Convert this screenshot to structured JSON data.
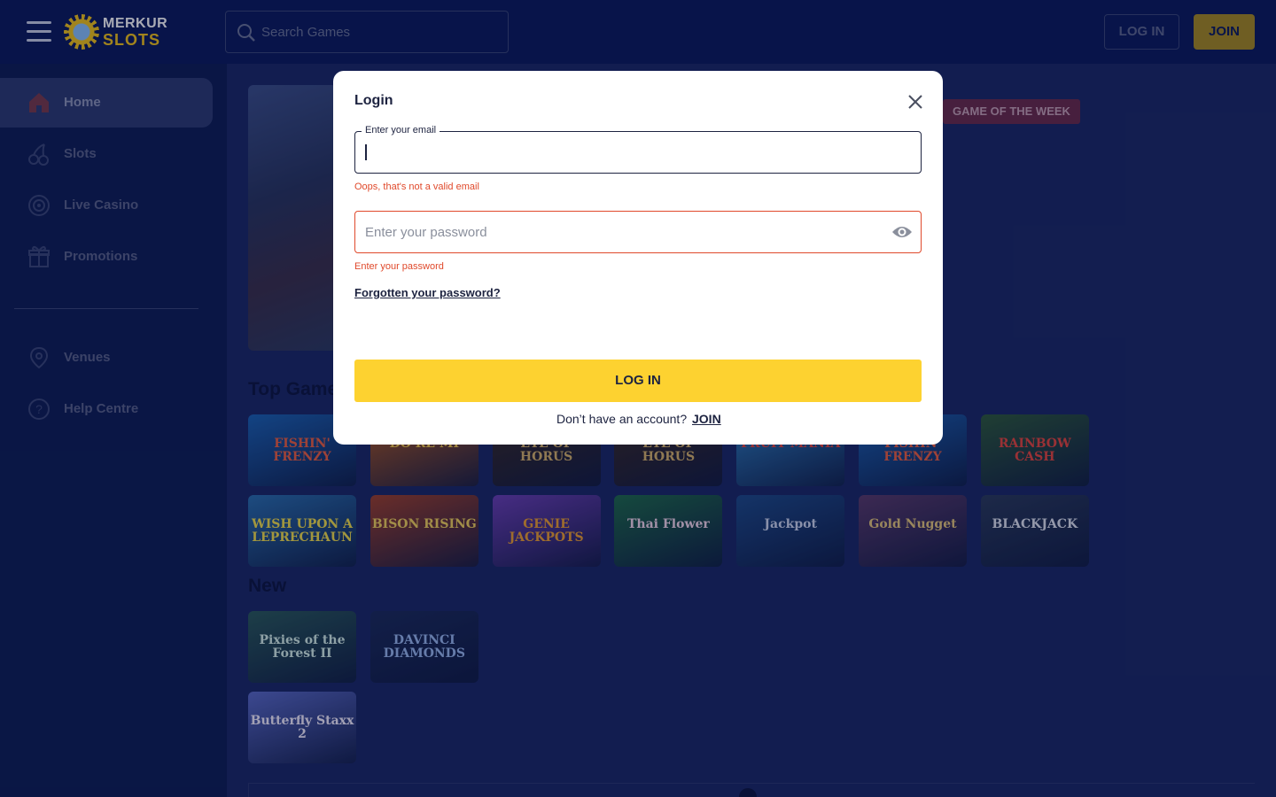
{
  "header": {
    "logo_line1": "MERKUR",
    "logo_line2": "SLOTS",
    "search_placeholder": "Search Games",
    "login_label": "LOG IN",
    "join_label": "JOIN"
  },
  "sidebar": {
    "items": [
      {
        "label": "Home",
        "icon": "home-icon",
        "active": true
      },
      {
        "label": "Slots",
        "icon": "cherries-icon"
      },
      {
        "label": "Live Casino",
        "icon": "roulette-icon"
      },
      {
        "label": "Promotions",
        "icon": "gift-icon"
      },
      {
        "label": "Venues",
        "icon": "location-pin-icon"
      },
      {
        "label": "Help Centre",
        "icon": "help-circle-icon"
      }
    ]
  },
  "main": {
    "badge": "GAME OF THE WEEK",
    "top_games_title": "Top Games",
    "new_title": "New",
    "top_games": [
      {
        "title": "FISHIN' FRENZY",
        "color": "#1b62b5",
        "text": "#f06040"
      },
      {
        "title": "DO RE MI",
        "color": "#b35a20",
        "text": "#f3c84a"
      },
      {
        "title": "EYE OF HORUS",
        "color": "#3a2a22",
        "text": "#d9b46a"
      },
      {
        "title": "EYE OF HORUS",
        "color": "#3b2a22",
        "text": "#d9b46a"
      },
      {
        "title": "FRUIT MANIA",
        "color": "#2f7fc2",
        "text": "#e8453c"
      },
      {
        "title": "FISHIN' FRENZY",
        "color": "#1b62b5",
        "text": "#f06040"
      },
      {
        "title": "RAINBOW CASH",
        "color": "#2e5a3a",
        "text": "#e8453c"
      },
      {
        "title": "WISH UPON A LEPRECHAUN",
        "color": "#2a6fb0",
        "text": "#f5e04a"
      },
      {
        "title": "BISON RISING",
        "color": "#a0402a",
        "text": "#f5d35a"
      },
      {
        "title": "GENIE JACKPOTS",
        "color": "#6b3fb5",
        "text": "#f0a030"
      },
      {
        "title": "Thai Flower",
        "color": "#1f6b4a",
        "text": "#f4d7ea"
      },
      {
        "title": "Jackpot",
        "color": "#1d4a8a",
        "text": "#cfd8f0"
      },
      {
        "title": "Gold Nugget",
        "color": "#5a3a6a",
        "text": "#e8c87a"
      },
      {
        "title": "BLACKJACK",
        "color": "#2a3a5a",
        "text": "#e0e4f0"
      }
    ],
    "new_games": [
      {
        "title": "Pixies of the Forest II",
        "color": "#2a5a5a",
        "text": "#d6f0e8"
      },
      {
        "title": "DAVINCI DIAMONDS",
        "color": "#1a2a5a",
        "text": "#9ab8f0"
      },
      {
        "title": "Butterfly Staxx 2",
        "color": "#5a6ac8",
        "text": "#f6f0ff"
      }
    ]
  },
  "modal": {
    "title": "Login",
    "email_label": "Enter your email",
    "email_error": "Oops, that's not a valid email",
    "password_placeholder": "Enter your password",
    "password_error": "Enter your password",
    "forgot_link": "Forgotten your password?",
    "submit_label": "LOG IN",
    "no_account_text": "Don’t have an account?",
    "join_link": "JOIN"
  }
}
